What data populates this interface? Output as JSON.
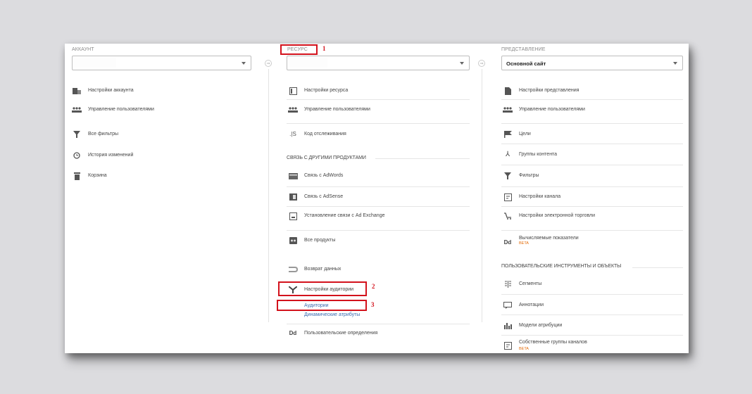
{
  "colors": {
    "red_annotation": "#d3121c",
    "link_blue": "#3c6bb0",
    "beta_orange": "#e46c0a"
  },
  "account": {
    "header": "АККАУНТ",
    "items": [
      {
        "icon": "building-icon",
        "label": "Настройки аккаунта"
      },
      {
        "icon": "users-icon",
        "label": "Управление пользователями"
      },
      {
        "icon": "filter-icon",
        "label": "Все фильтры"
      },
      {
        "icon": "history-icon",
        "label": "История изменений"
      },
      {
        "icon": "trash-icon",
        "label": "Корзина"
      }
    ]
  },
  "resource": {
    "header": "РЕСУРС",
    "items": [
      {
        "icon": "property-icon",
        "label": "Настройки ресурса"
      },
      {
        "icon": "users-icon",
        "label": "Управление пользователями"
      },
      {
        "icon": "js-icon",
        "label": "Код отслеживания"
      }
    ],
    "section_title": "СВЯЗЬ С ДРУГИМИ ПРОДУКТАМИ",
    "links": [
      {
        "icon": "adwords-icon",
        "label": "Связь с AdWords"
      },
      {
        "icon": "adsense-icon",
        "label": "Связь с AdSense"
      },
      {
        "icon": "adexchange-icon",
        "label": "Установление связи с Ad Exchange"
      },
      {
        "icon": "products-icon",
        "label": "Все продукты"
      }
    ],
    "data_return": "Возврат данных",
    "audience_settings": "Настройки аудитории",
    "audiences": "Аудитории",
    "dynamic_attributes": "Динамические атрибуты",
    "custom_definitions": "Пользовательские определения",
    "custom_definitions_icon": "Dd"
  },
  "view": {
    "header": "ПРЕДСТАВЛЕНИЕ",
    "selected": "Основной сайт",
    "items": [
      {
        "icon": "doc-icon",
        "label": "Настройки представления"
      },
      {
        "icon": "users-icon",
        "label": "Управление пользователями"
      },
      {
        "icon": "flag-icon",
        "label": "Цели"
      },
      {
        "icon": "content-group-icon",
        "label": "Группы контента"
      },
      {
        "icon": "filter-icon",
        "label": "Фильтры"
      },
      {
        "icon": "channel-icon",
        "label": "Настройки канала"
      },
      {
        "icon": "cart-icon",
        "label": "Настройки электронной торговли"
      }
    ],
    "calc_metrics": "Вычисляемые показатели",
    "calc_metrics_beta": "BETA",
    "calc_metrics_icon": "Dd",
    "section_title": "ПОЛЬЗОВАТЕЛЬСКИЕ ИНСТРУМЕНТЫ И ОБЪЕКТЫ",
    "tools": [
      {
        "icon": "segments-icon",
        "label": "Сегменты"
      },
      {
        "icon": "annotation-icon",
        "label": "Аннотации"
      },
      {
        "icon": "attribution-icon",
        "label": "Модели атрибуции"
      }
    ],
    "custom_channels": "Собственные группы каналов",
    "custom_channels_beta": "BETA"
  },
  "annotations": [
    "1",
    "2",
    "3"
  ]
}
